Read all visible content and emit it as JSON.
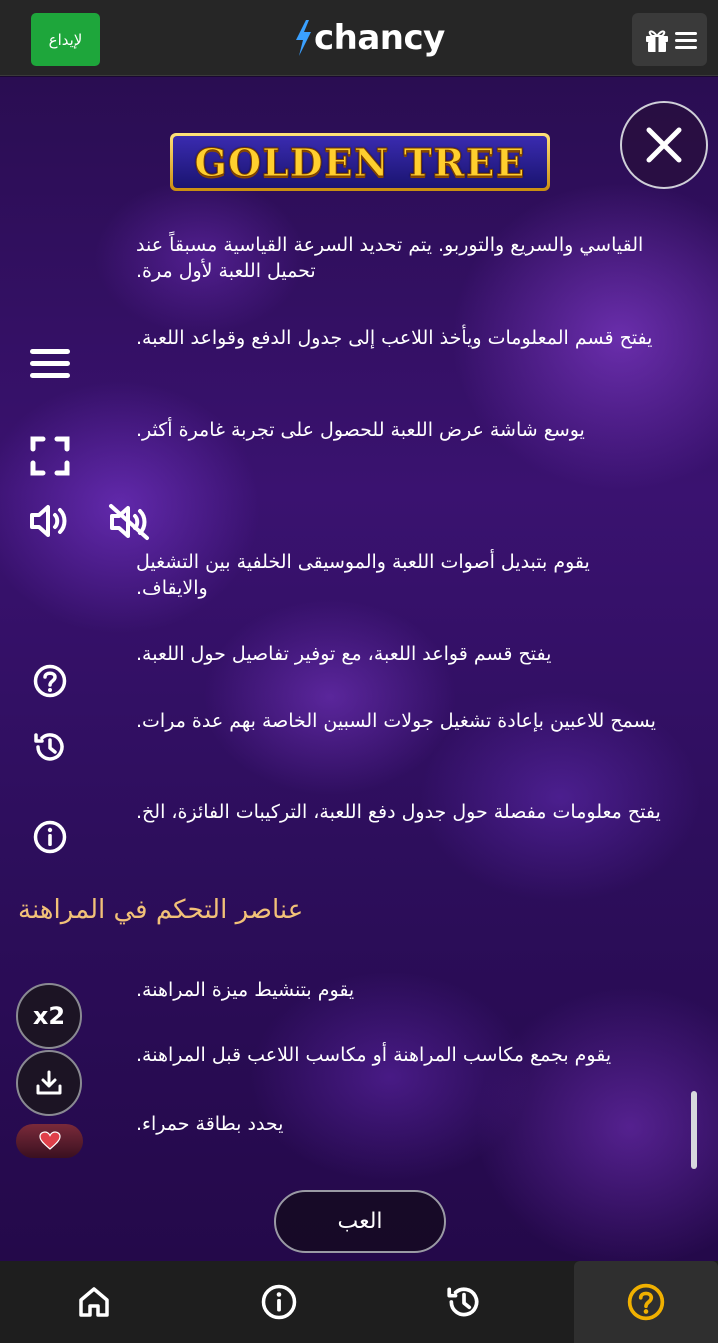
{
  "topbar": {
    "deposit_label": "لإيداع",
    "logo_text": "chancy",
    "gift_icon": "gift-icon",
    "menu_icon": "hamburger-icon"
  },
  "game": {
    "title": "GOLDEN TREE",
    "texts": [
      "القياسي والسريع والتوربو. يتم تحديد السرعة القياسية مسبقاً عند تحميل اللعبة لأول مرة.",
      "يفتح قسم المعلومات ويأخذ اللاعب إلى جدول الدفع وقواعد اللعبة.",
      "يوسع شاشة عرض اللعبة للحصول على تجربة غامرة أكثر.",
      "يقوم بتبديل أصوات اللعبة والموسيقى الخلفية بين التشغيل والايقاف.",
      "يفتح قسم قواعد اللعبة، مع توفير تفاصيل حول اللعبة.",
      "يسمح للاعبين بإعادة تشغيل جولات السبين الخاصة بهم عدة مرات.",
      "يفتح معلومات مفصلة حول جدول دفع اللعبة، التركيبات الفائزة، الخ."
    ],
    "bet_heading": "عناصر التحكم في المراهنة",
    "bet_texts": [
      "يقوم بتنشيط ميزة المراهنة.",
      "يقوم بجمع مكاسب المراهنة أو مكاسب اللاعب قبل المراهنة.",
      "يحدد بطاقة حمراء."
    ],
    "x2_label": "x2",
    "play_label": "العب"
  },
  "colors": {
    "deposit": "#1ea63b",
    "heading": "#f2c178",
    "title_gold": "#ffcf2e",
    "background": "#2a0d52"
  },
  "bottom_nav": [
    "home-icon",
    "info-icon",
    "history-icon",
    "help-icon"
  ]
}
